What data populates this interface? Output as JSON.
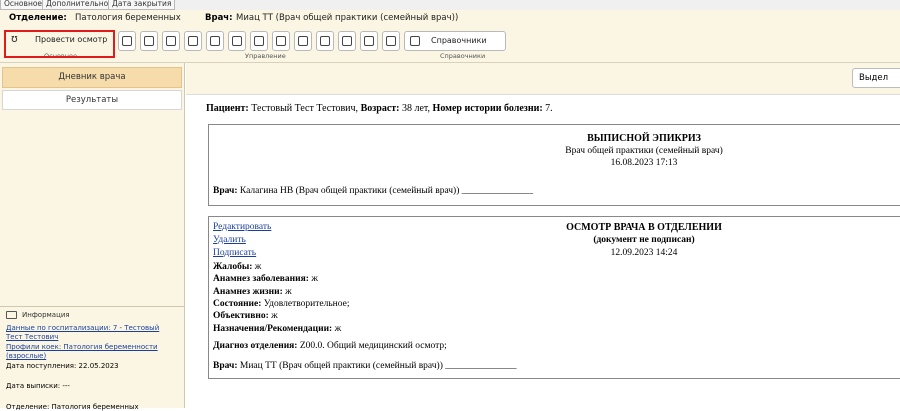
{
  "tabs": [
    "Основное",
    "Дополнительно",
    "Дата закрытия"
  ],
  "header": {
    "dept_label": "Отделение:",
    "dept_value": "Патология беременных",
    "doctor_label": "Врач:",
    "doctor_value": "Миац ТТ (Врач общей практики (семейный врач))"
  },
  "ribbon": {
    "exam_button": "Провести осмотр",
    "handbooks_button": "Справочники",
    "group_main": "Основное",
    "group_manage": "Управление",
    "group_handbooks": "Справочники",
    "icons": [
      "patient-card-icon",
      "document-icon",
      "stamp-icon",
      "scissors-icon",
      "lab-flask-icon",
      "medications-icon",
      "report-icon",
      "edit-report-icon",
      "edit-pen-icon",
      "print-icon",
      "team-icon",
      "transfer-icon",
      "print-form-icon"
    ]
  },
  "left": {
    "diary": "Дневник врача",
    "results": "Результаты",
    "info_title": "Информация",
    "hosp_link_1": "Данные по госпитализации: 7 - Тестовый",
    "hosp_link_2": "Тест Тестович",
    "profile_link_1": "Профили коек: Патология беременности",
    "profile_link_2": "(взрослые)",
    "admission": "Дата поступления: 22.05.2023",
    "discharge": "Дата выписки: ---",
    "bottom": "Отделение: Патология беременных"
  },
  "main": {
    "select_button": "Выдел",
    "patient_label": "Пациент:",
    "patient_name": "Тестовый Тест Тестович,",
    "age_label": "Возраст:",
    "age_value": "38 лет,",
    "history_label": "Номер истории болезни:",
    "history_value": "7."
  },
  "epicrisis": {
    "title": "ВЫПИСНОЙ ЭПИКРИЗ",
    "subtitle": "Врач общей практики (семейный врач)",
    "datetime": "16.08.2023 17:13",
    "doctor_label": "Врач:",
    "doctor_value": "Калагина НВ (Врач общей практики (семейный врач)) _______________"
  },
  "exam": {
    "edit_link": "Редактировать",
    "delete_link": "Удалить",
    "sign_link": "Подписать",
    "title": "ОСМОТР ВРАЧА В ОТДЕЛЕНИИ",
    "status": "(документ не подписан)",
    "datetime": "12.09.2023 14:24",
    "complaints_label": "Жалобы:",
    "complaints_value": "ж",
    "anamnesis_disease_label": "Анамнез заболевания:",
    "anamnesis_disease_value": "ж",
    "anamnesis_life_label": "Анамнез жизни:",
    "anamnesis_life_value": "ж",
    "state_label": "Состояние:",
    "state_value": "Удовлетворительное;",
    "objective_label": "Объективно:",
    "objective_value": "ж",
    "prescriptions_label": "Назначения/Рекомендации:",
    "prescriptions_value": "ж",
    "diagnosis_label": "Диагноз отделения:",
    "diagnosis_value": "Z00.0. Общий медицинский осмотр;",
    "doctor_label": "Врач:",
    "doctor_value": "Миац ТТ (Врач общей практики (семейный врач)) _______________"
  }
}
